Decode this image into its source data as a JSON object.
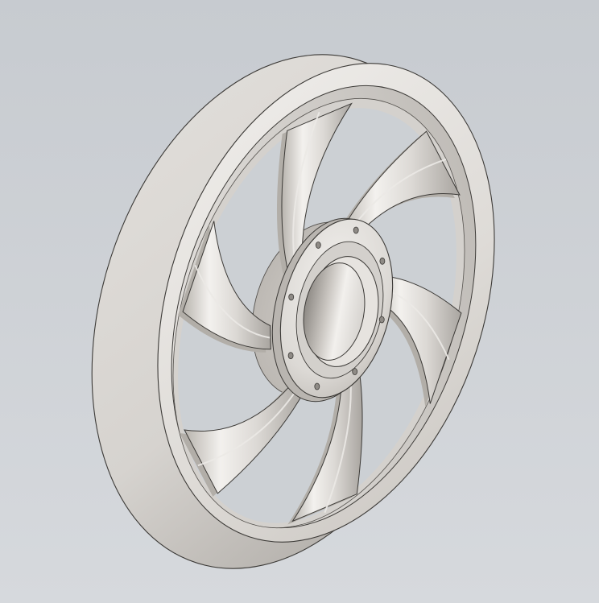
{
  "viewport": {
    "background_top": "#c7cbd0",
    "background_bottom": "#d6d9dd"
  },
  "model": {
    "name": "",
    "spoke_count": 6,
    "hole_count": 8,
    "colors": {
      "body": "#d8d5d1",
      "body_light": "#ebe9e6",
      "body_dark": "#b2aea8",
      "shadow": "#8f8b86",
      "edge": "#3c3a37"
    }
  }
}
